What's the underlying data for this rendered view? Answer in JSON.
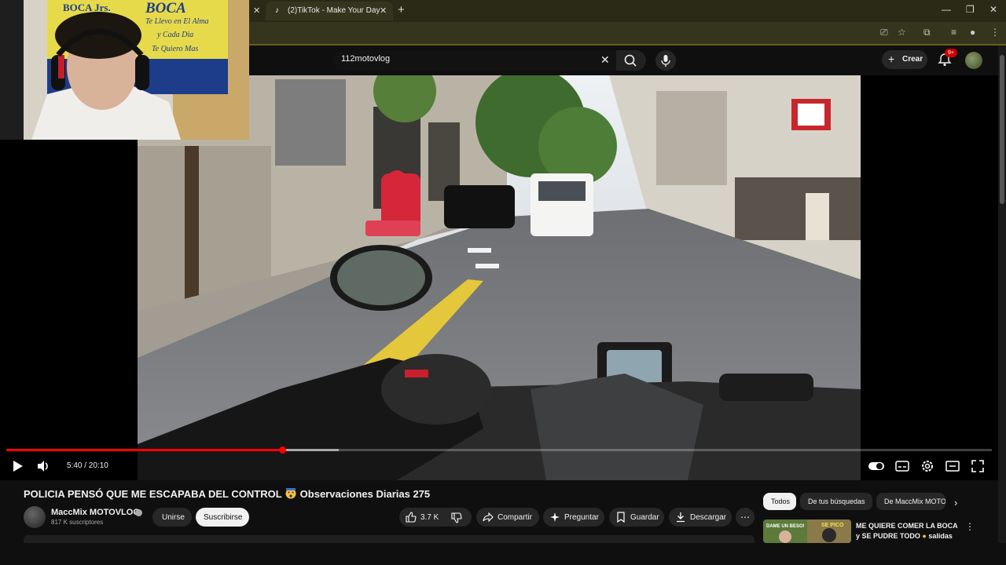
{
  "browser": {
    "tab_title": "(2)TikTok - Make Your Day"
  },
  "masthead": {
    "search_value": "112motovlog",
    "create_label": "Crear",
    "notification_count": "9+"
  },
  "player": {
    "time": "5:40 / 20:10",
    "progress": 0.28,
    "buffered": 0.337
  },
  "video": {
    "title": "POLICIA PENSÓ QUE ME ESCAPABA DEL CONTROL",
    "title_suffix": " Observaciones Diarias 275",
    "channel_name": "MaccMix MOTOVLOG",
    "subscribers": "817 K suscriptores",
    "join_label": "Unirse",
    "subscribe_label": "Suscribirse",
    "like_count": "3.7 K",
    "share_label": "Compartir",
    "ask_label": "Preguntar",
    "save_label": "Guardar",
    "download_label": "Descargar"
  },
  "chips": [
    "Todos",
    "De tus búsquedas",
    "De MaccMix MOTO"
  ],
  "recommendation": {
    "title": "ME QUIERE COMER LA BOCA y SE PUDRE TODO",
    "title_suffix": " salidas de..."
  },
  "webcam_flag": {
    "line1": "BOCA Jrs.",
    "line2": "BOCA",
    "line3": "Te Llevo en El Alma",
    "line4": "y Cada Dia",
    "line5": "Te Quiero Mas"
  },
  "thumb_text": {
    "left": "DAME UN BESO!",
    "right": "SE PICO"
  },
  "colors": {
    "accent_red": "#ff0000",
    "tabbar": "#2b2a16",
    "background": "#0f0f0f"
  }
}
